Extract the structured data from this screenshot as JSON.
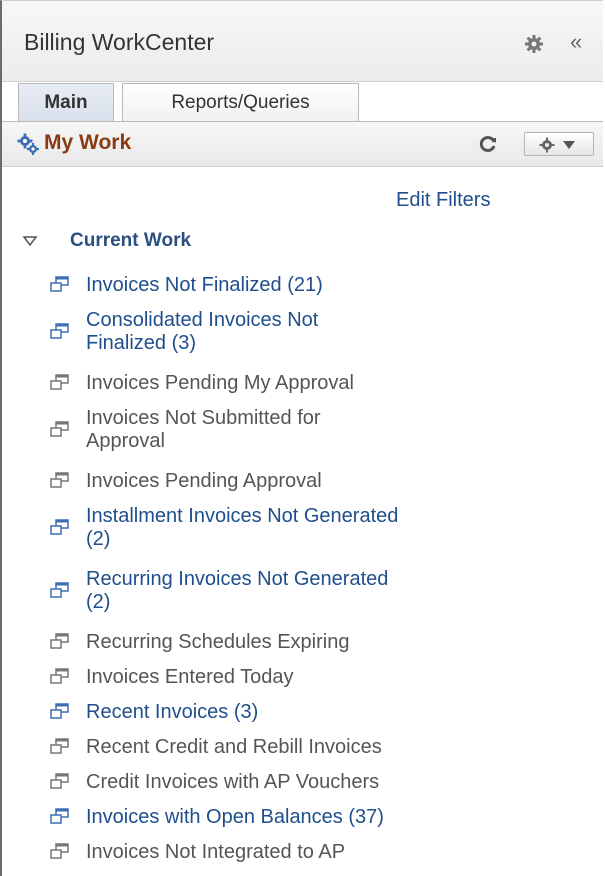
{
  "header": {
    "title": "Billing WorkCenter",
    "collapse_glyph": "«",
    "gear_icon": "gear-icon"
  },
  "tabs": [
    {
      "label": "Main",
      "active": true
    },
    {
      "label": "Reports/Queries",
      "active": false
    }
  ],
  "pagelet": {
    "title": "My Work",
    "icon": "gears-icon",
    "refresh_icon": "refresh-icon",
    "actions_icon": "gear-dropdown-icon"
  },
  "edit_filters": "Edit Filters",
  "section": {
    "title": "Current Work",
    "expanded": true
  },
  "colors": {
    "link": "#1f4e8c",
    "plain_text": "#555555",
    "pagelet_title": "#8a3b12"
  },
  "items": [
    {
      "lines": [
        "Invoices Not Finalized (21)"
      ],
      "link": true
    },
    {
      "lines": [
        "Consolidated Invoices Not",
        "Finalized (3)"
      ],
      "link": true
    },
    {
      "lines": [
        "Invoices Pending My Approval"
      ],
      "link": false
    },
    {
      "lines": [
        "Invoices Not Submitted for",
        "Approval"
      ],
      "link": false
    },
    {
      "lines": [
        "Invoices Pending Approval"
      ],
      "link": false
    },
    {
      "lines": [
        "Installment Invoices Not Generated",
        "(2)"
      ],
      "link": true
    },
    {
      "lines": [
        "Recurring Invoices Not Generated",
        "(2)"
      ],
      "link": true
    },
    {
      "lines": [
        "Recurring Schedules Expiring"
      ],
      "link": false
    },
    {
      "lines": [
        "Invoices Entered Today"
      ],
      "link": false
    },
    {
      "lines": [
        "Recent Invoices (3)"
      ],
      "link": true
    },
    {
      "lines": [
        "Recent Credit and Rebill Invoices"
      ],
      "link": false
    },
    {
      "lines": [
        "Credit Invoices with AP Vouchers"
      ],
      "link": false
    },
    {
      "lines": [
        "Invoices with Open Balances (37)"
      ],
      "link": true
    },
    {
      "lines": [
        "Invoices Not Integrated to AP"
      ],
      "link": false
    }
  ]
}
